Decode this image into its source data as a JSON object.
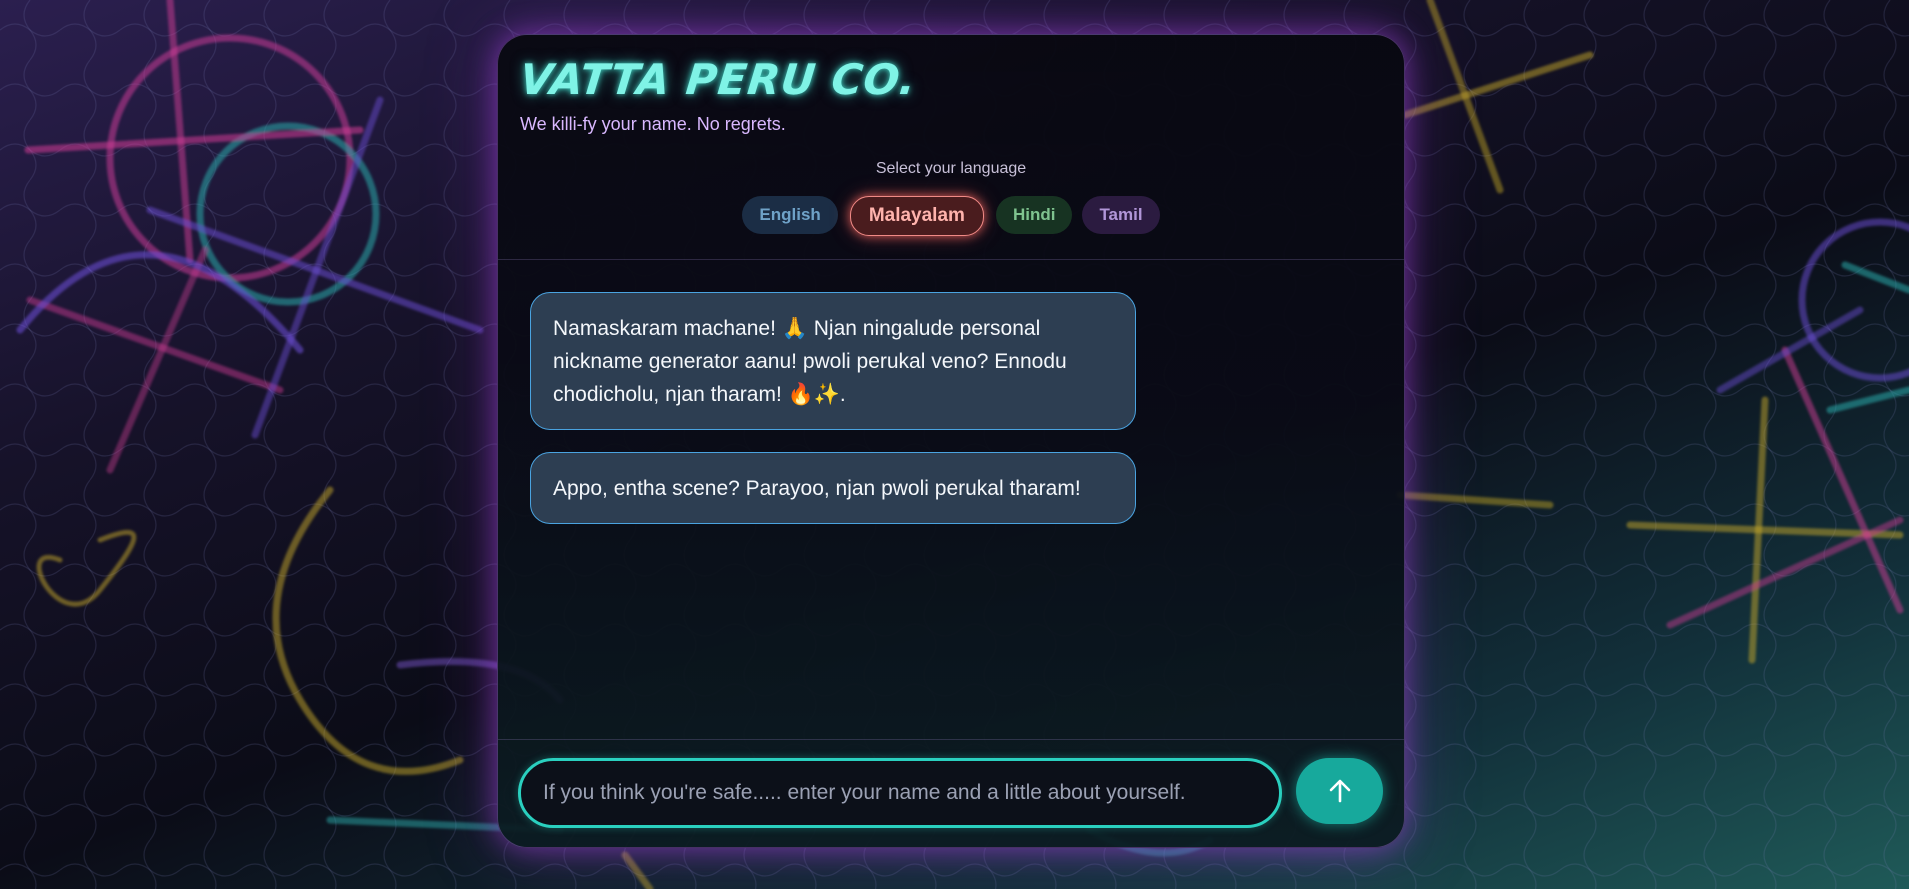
{
  "app": {
    "logo_text": "VATTA PERU CO.",
    "tagline": "We killi-fy your name. No regrets."
  },
  "language": {
    "label": "Select your language",
    "options": [
      "English",
      "Malayalam",
      "Hindi",
      "Tamil"
    ],
    "selected": "Malayalam"
  },
  "messages": [
    {
      "role": "bot",
      "text": "Namaskaram machane! 🙏 Njan ningalude personal nickname generator aanu! pwoli perukal veno? Ennodu chodicholu, njan tharam! 🔥✨."
    },
    {
      "role": "bot",
      "text": "Appo, entha scene? Parayoo, njan pwoli perukal tharam!"
    }
  ],
  "composer": {
    "placeholder": "If you think you're safe..... enter your name and a little about yourself.",
    "value": "",
    "send_icon": "arrow-up-icon"
  },
  "colors": {
    "accent_teal": "#2ad0bf",
    "logo_glow": "#7ff3e6",
    "tagline": "#d9b8ff",
    "bubble_bg": "#2d3e52",
    "bubble_border": "#4aa3e0",
    "selected_chip": "#f08a86"
  }
}
